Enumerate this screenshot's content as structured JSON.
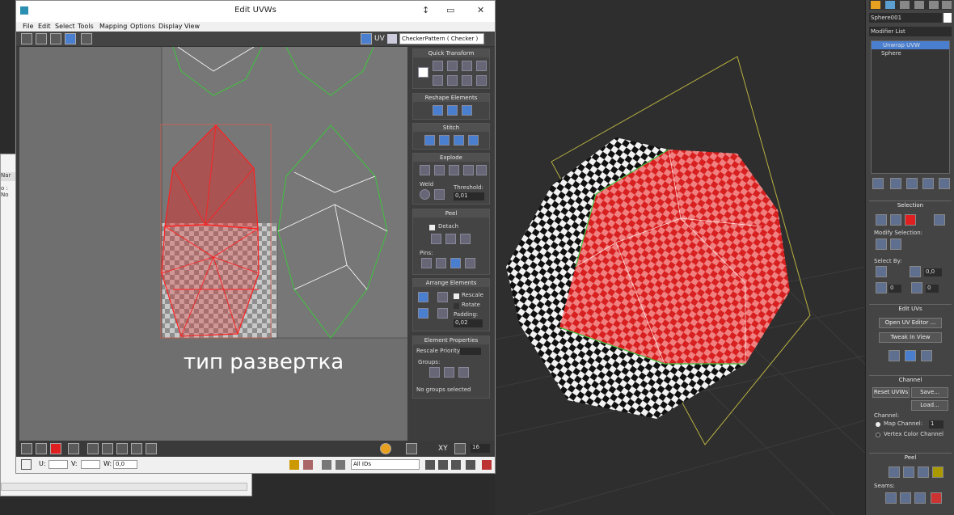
{
  "uv_editor": {
    "title": "Edit UVWs",
    "win_min": "↕",
    "win_restore": "▭",
    "win_close": "✕",
    "menu": [
      "File",
      "Edit",
      "Select",
      "Tools",
      "Mapping",
      "Options",
      "Display",
      "View"
    ],
    "uv_label": "UV",
    "texture_dropdown": "CheckerPattern  ( Checker )",
    "caption": "тип развертка",
    "panels": {
      "quick_transform": "Quick Transform",
      "reshape": "Reshape Elements",
      "stitch": "Stitch",
      "explode": "Explode",
      "weld": "Weld",
      "threshold_label": "Threshold:",
      "threshold_value": "0,01",
      "peel": "Peel",
      "detach": "Detach",
      "pins": "Pins:",
      "arrange": "Arrange Elements",
      "rescale": "Rescale",
      "rotate": "Rotate",
      "padding_label": "Padding:",
      "padding_value": "0,02",
      "element_props": "Element Properties",
      "rescale_priority": "Rescale Priority:",
      "groups": "Groups:",
      "no_groups": "No groups selected"
    },
    "bottom": {
      "xy": "XY",
      "grid_value": "16"
    },
    "status": {
      "u": "U:",
      "v": "V:",
      "w": "W:",
      "w_value": "0,0",
      "ids": "All IDs"
    }
  },
  "bg_window": {
    "tab": "Nar",
    "text": "o : No"
  },
  "command_panel": {
    "object_name": "Sphere001",
    "modifier_list": "Modifier List",
    "stack": [
      "Unwrap UVW",
      "Sphere"
    ],
    "selection": "Selection",
    "modify_selection": "Modify Selection:",
    "select_by": "Select By:",
    "select_by_value": "0,0",
    "angle_value_1": "0",
    "angle_value_2": "0",
    "edit_uvs": "Edit UVs",
    "open_uv_editor": "Open UV Editor ...",
    "tweak_in_view": "Tweak In View",
    "channel": "Channel",
    "reset_uvws": "Reset UVWs",
    "save": "Save...",
    "load": "Load...",
    "channel_label": "Channel:",
    "map_channel": "Map Channel:",
    "map_channel_value": "1",
    "vertex_color_channel": "Vertex Color Channel",
    "peel": "Peel",
    "seams": "Seams:"
  },
  "colors": {
    "selection_red": "#e02020",
    "seam_green": "#3ec43e",
    "panel_blue": "#4a7fd0"
  }
}
